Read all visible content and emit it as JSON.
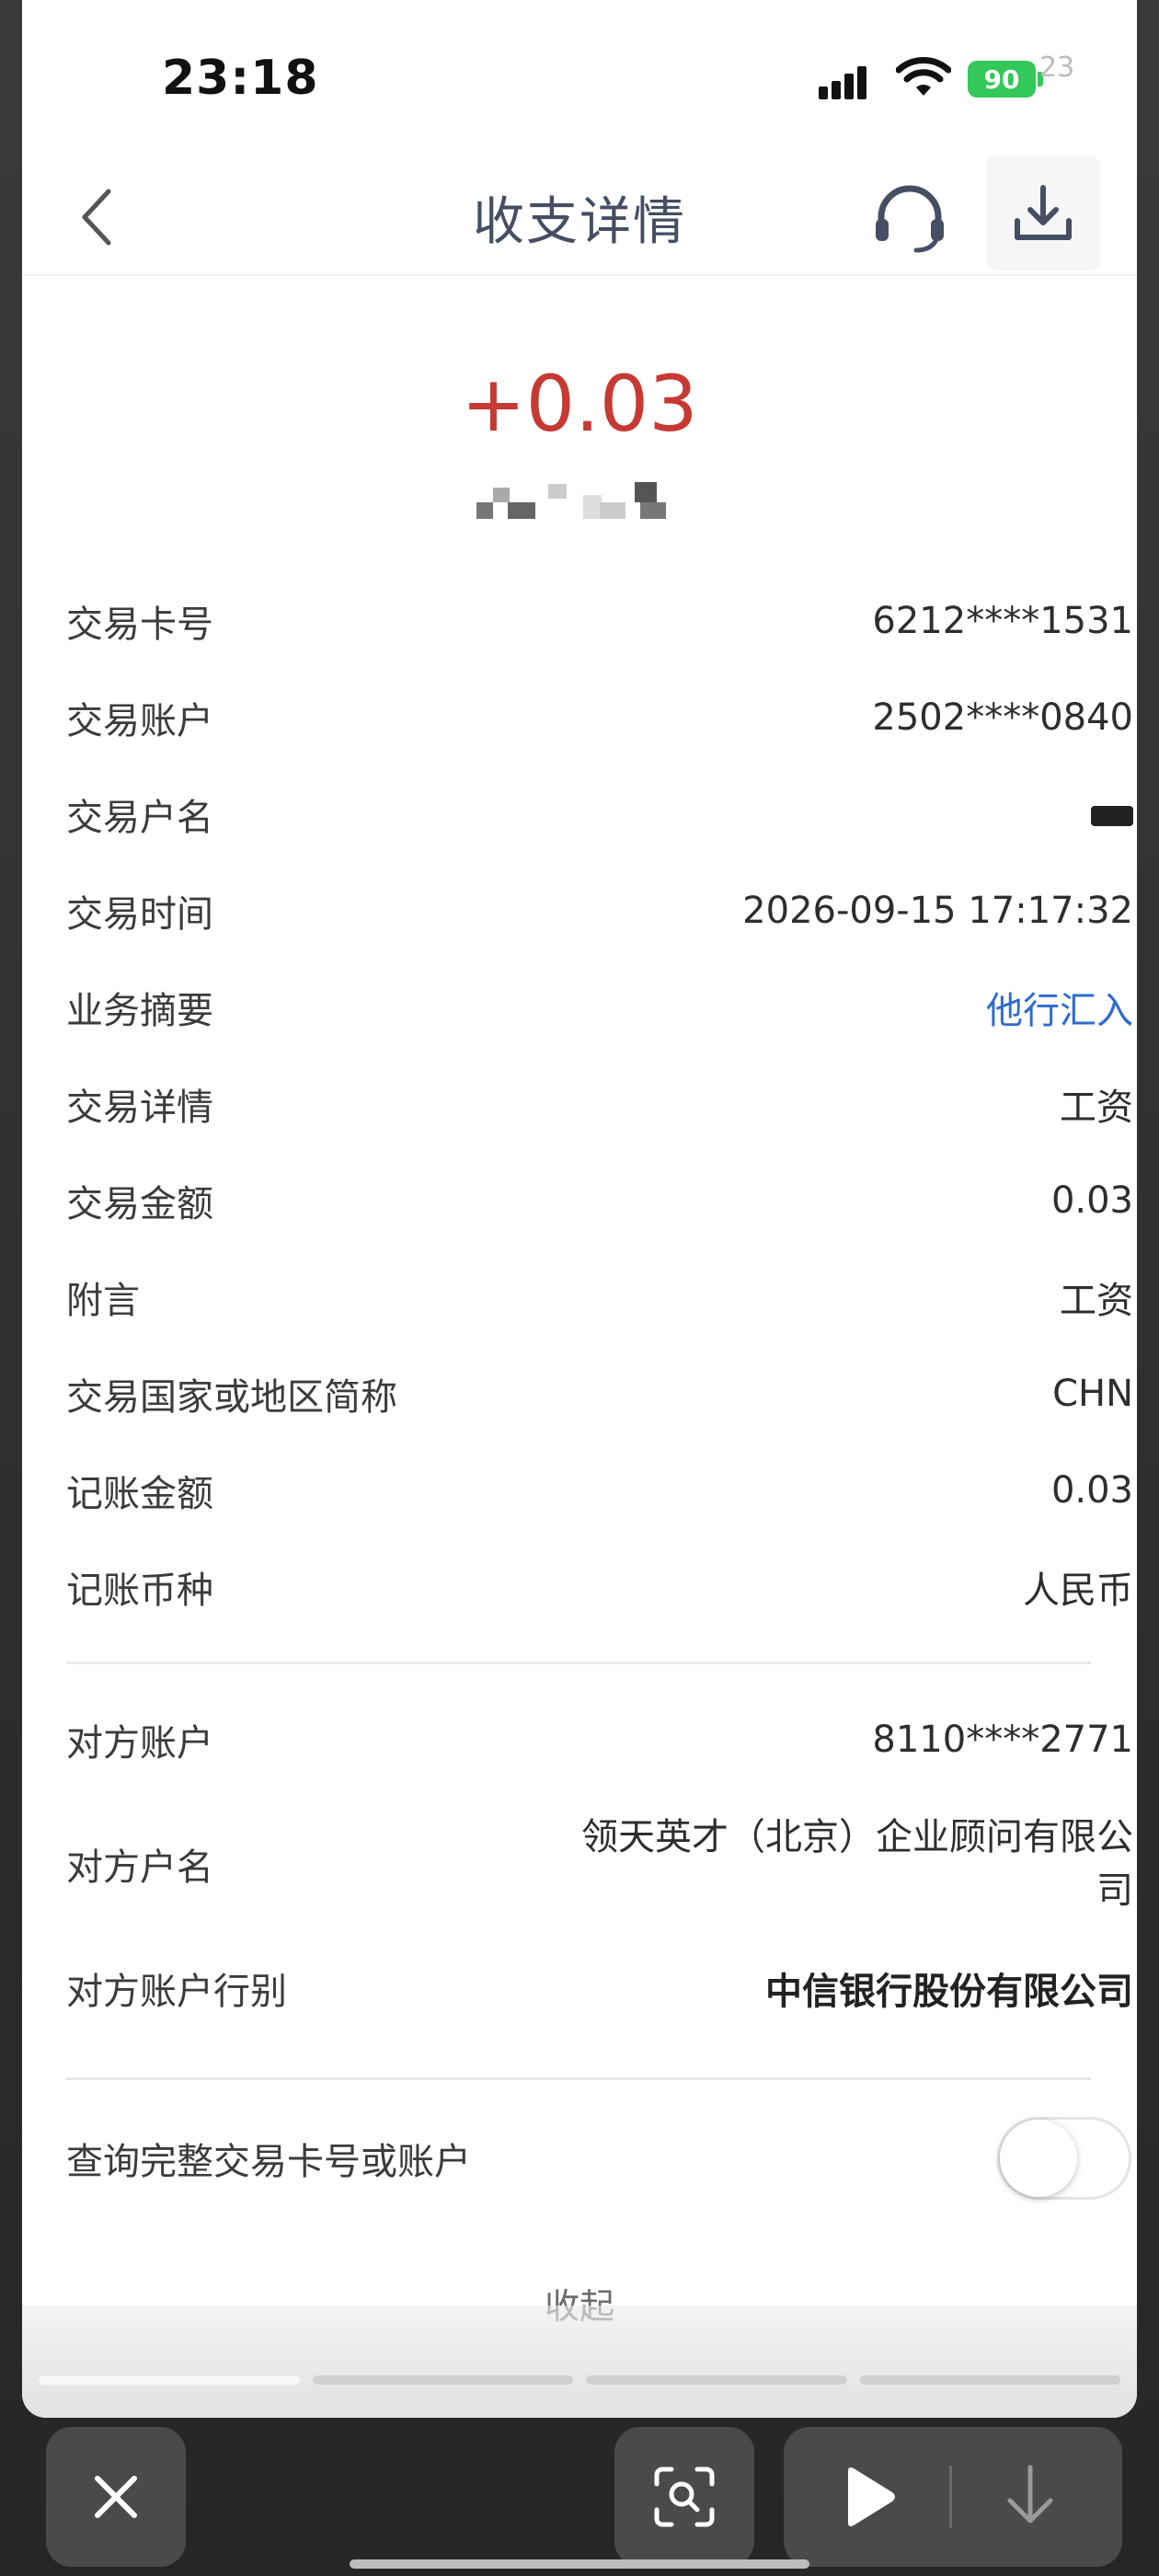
{
  "status_bar": {
    "time": "23:18",
    "battery": "90",
    "extra": "23"
  },
  "header": {
    "title": "收支详情",
    "back_icon": "chevron-left-icon",
    "support_icon": "headset-icon",
    "download_icon": "download-icon"
  },
  "transaction": {
    "amount": "+0.03",
    "amount_color": "#c63a33"
  },
  "details": [
    {
      "label": "交易卡号",
      "value": "6212****1531"
    },
    {
      "label": "交易账户",
      "value": "2502****0840"
    },
    {
      "label": "交易户名",
      "value": ""
    },
    {
      "label": "交易时间",
      "value": "2026-09-15 17:17:32"
    },
    {
      "label": "业务摘要",
      "value": "他行汇入"
    },
    {
      "label": "交易详情",
      "value": "工资"
    },
    {
      "label": "交易金额",
      "value": "0.03"
    },
    {
      "label": "附言",
      "value": "工资"
    },
    {
      "label": "交易国家或地区简称",
      "value": "CHN"
    },
    {
      "label": "记账金额",
      "value": "0.03"
    },
    {
      "label": "记账币种",
      "value": "人民币"
    }
  ],
  "counterparty": [
    {
      "label": "对方账户",
      "value": "8110****2771"
    },
    {
      "label": "对方户名",
      "value": "领天英才（北京）企业顾问有限公司"
    },
    {
      "label": "对方账户行别",
      "value": "中信银行股份有限公司"
    }
  ],
  "query_full": {
    "label": "查询完整交易卡号或账户",
    "enabled": false
  },
  "collapse_label": "收起",
  "link_color": "#2f6bcf",
  "viewer": {
    "progress_segments": 4,
    "active_segment": 1
  }
}
